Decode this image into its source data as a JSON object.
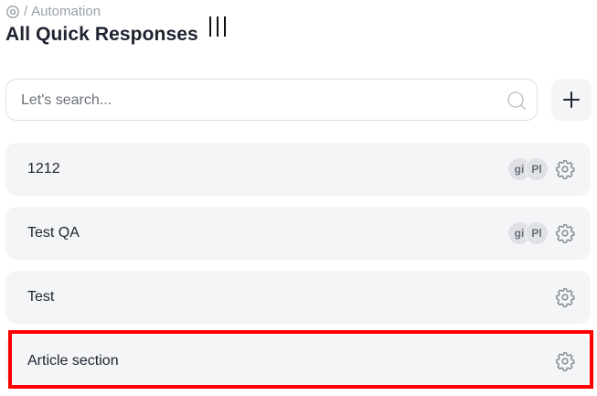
{
  "breadcrumb": {
    "separator": "/",
    "section": "Automation"
  },
  "page": {
    "title": "All Quick Responses"
  },
  "search": {
    "placeholder": "Let's search...",
    "value": ""
  },
  "toolbar": {
    "add_label": "+"
  },
  "responses": [
    {
      "label": "1212",
      "avatars": [
        "gi",
        "Pl"
      ]
    },
    {
      "label": "Test QA",
      "avatars": [
        "gi",
        "Pl"
      ]
    },
    {
      "label": "Test",
      "avatars": []
    },
    {
      "label": "Article section",
      "avatars": [],
      "highlighted": true
    }
  ],
  "colors": {
    "highlight": "#ff0000",
    "row_bg": "#f4f5f7",
    "avatar_bg": "#dfe1e6"
  }
}
